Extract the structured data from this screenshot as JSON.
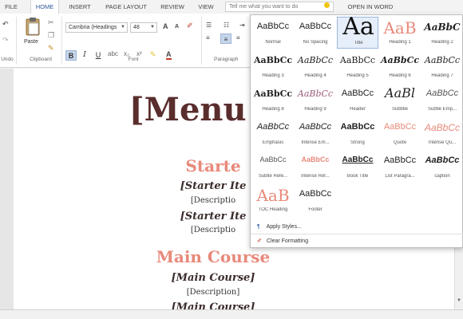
{
  "tabs": [
    {
      "label": "FILE",
      "active": false
    },
    {
      "label": "HOME",
      "active": true
    },
    {
      "label": "INSERT",
      "active": false
    },
    {
      "label": "PAGE LAYOUT",
      "active": false
    },
    {
      "label": "REVIEW",
      "active": false
    },
    {
      "label": "VIEW",
      "active": false
    },
    {
      "label": "OPEN IN WORD",
      "active": false
    }
  ],
  "tell_me": {
    "placeholder": "Tell me what you want to do"
  },
  "ribbon": {
    "undo_label": "Undo",
    "paste_label": "Paste",
    "clipboard_label": "Clipboard",
    "font_label": "Font",
    "paragraph_label": "Paragraph",
    "font_name": "Cambria (Headings",
    "font_size": "48",
    "bold": "B",
    "italic": "I",
    "underline": "U",
    "grow_font": "A",
    "shrink_font": "A",
    "font_color": "A"
  },
  "styles_gallery": {
    "styles": [
      {
        "preview": "AaBbCc",
        "name": "Normal"
      },
      {
        "preview": "AaBbCc",
        "name": "No Spacing"
      },
      {
        "preview": "Aa",
        "name": "Title",
        "selected": true
      },
      {
        "preview": "AaB",
        "name": "Heading 1"
      },
      {
        "preview": "AaBbC",
        "name": "Heading 2"
      },
      {
        "preview": "AaBbCc",
        "name": "Heading 3"
      },
      {
        "preview": "AaBbCc",
        "name": "Heading 4"
      },
      {
        "preview": "AaBbCc",
        "name": "Heading 5"
      },
      {
        "preview": "AaBbCc",
        "name": "Heading 6"
      },
      {
        "preview": "AaBbCc",
        "name": "Heading 7"
      },
      {
        "preview": "AaBbCc",
        "name": "Heading 8"
      },
      {
        "preview": "AaBbCc",
        "name": "Heading 9"
      },
      {
        "preview": "AaBbCc",
        "name": "Header"
      },
      {
        "preview": "AaBl",
        "name": "Subtitle"
      },
      {
        "preview": "AaBbCc",
        "name": "Subtle Emp..."
      },
      {
        "preview": "AaBbCc",
        "name": "Emphasis"
      },
      {
        "preview": "AaBbCc",
        "name": "Intense Em..."
      },
      {
        "preview": "AaBbCc",
        "name": "Strong"
      },
      {
        "preview": "AaBbCc",
        "name": "Quote"
      },
      {
        "preview": "AaBbCc",
        "name": "Intense Qu..."
      },
      {
        "preview": "AaBbCc",
        "name": "Subtle Refe..."
      },
      {
        "preview": "AaBbCc",
        "name": "Intense Ref..."
      },
      {
        "preview": "AaBbCc",
        "name": "Book Title"
      },
      {
        "preview": "AaBbCc",
        "name": "List Paragra..."
      },
      {
        "preview": "AaBbCc",
        "name": "caption"
      },
      {
        "preview": "AaB",
        "name": "TOC Heading"
      },
      {
        "preview": "AaBbCc",
        "name": "Footer"
      }
    ],
    "apply_styles": "Apply Styles...",
    "clear_formatting": "Clear Formatting"
  },
  "document": {
    "title": "[Menu T",
    "starters_heading": "Starte",
    "starter_item_1": "[Starter Ite",
    "starter_desc_1": "[Descriptio",
    "starter_item_2": "[Starter Ite",
    "starter_desc_2": "[Descriptio",
    "main_heading": "Main Course",
    "main_item_1": "[Main Course]",
    "main_desc_1": "[Description]",
    "main_item_2": "[Main Course]"
  },
  "colors": {
    "accent": "#2b579a",
    "heading_salmon": "#e8897a",
    "title_dark": "#5a2d2d"
  }
}
